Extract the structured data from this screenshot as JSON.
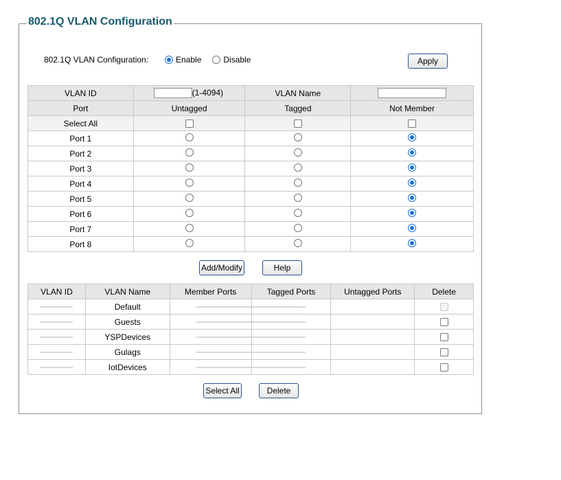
{
  "legend": "802.1Q VLAN Configuration",
  "global": {
    "label": "802.1Q VLAN Configuration:",
    "enable_label": "Enable",
    "disable_label": "Disable",
    "selected": "Enable",
    "apply_label": "Apply"
  },
  "config_table": {
    "vlan_id_label": "VLAN ID",
    "vlan_id_value": "",
    "vlan_id_range": "(1-4094)",
    "vlan_name_label": "VLAN Name",
    "vlan_name_value": "",
    "headers": [
      "Port",
      "Untagged",
      "Tagged",
      "Not Member"
    ],
    "select_all_label": "Select All",
    "ports": [
      {
        "name": "Port 1",
        "mode": "Not Member"
      },
      {
        "name": "Port 2",
        "mode": "Not Member"
      },
      {
        "name": "Port 3",
        "mode": "Not Member"
      },
      {
        "name": "Port 4",
        "mode": "Not Member"
      },
      {
        "name": "Port 5",
        "mode": "Not Member"
      },
      {
        "name": "Port 6",
        "mode": "Not Member"
      },
      {
        "name": "Port 7",
        "mode": "Not Member"
      },
      {
        "name": "Port 8",
        "mode": "Not Member"
      }
    ]
  },
  "buttons": {
    "add_modify": "Add/Modify",
    "help": "Help",
    "select_all": "Select All",
    "delete": "Delete"
  },
  "vlan_table": {
    "headers": [
      "VLAN ID",
      "VLAN Name",
      "Member Ports",
      "Tagged Ports",
      "Untagged Ports",
      "Delete"
    ],
    "rows": [
      {
        "name": "Default",
        "delete_disabled": true
      },
      {
        "name": "Guests",
        "delete_disabled": false
      },
      {
        "name": "YSPDevices",
        "delete_disabled": false
      },
      {
        "name": "Gulags",
        "delete_disabled": false
      },
      {
        "name": "IotDevices",
        "delete_disabled": false
      }
    ]
  },
  "colors": {
    "legend": "#1a5a6e",
    "radio_selected": "#1a6fd6",
    "header_bg": "#e6e6e6"
  }
}
